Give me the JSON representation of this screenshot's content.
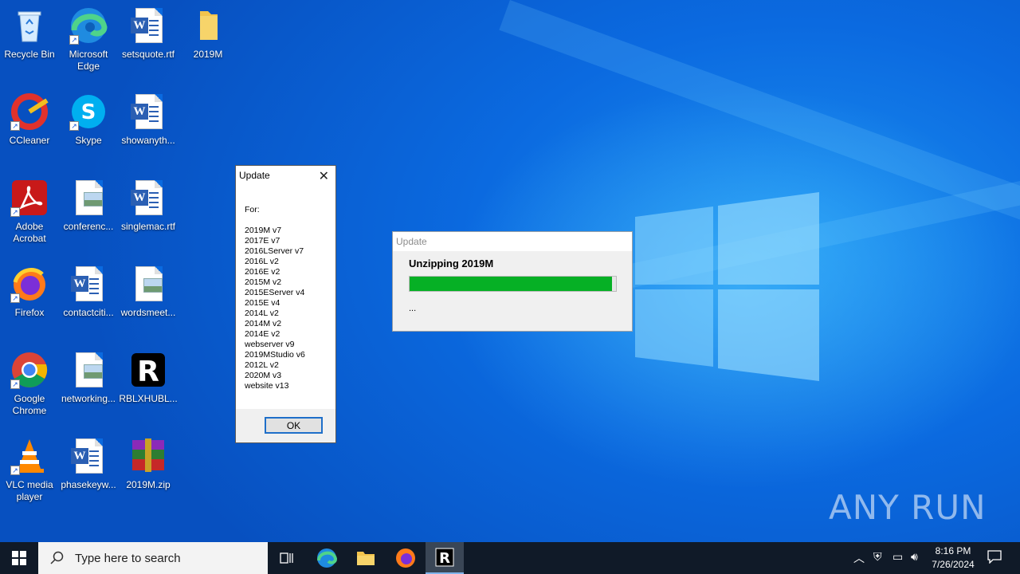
{
  "desktop": {
    "icons": [
      {
        "label": "Recycle Bin",
        "icon": "recycle-bin-icon"
      },
      {
        "label": "Microsoft Edge",
        "icon": "edge-icon"
      },
      {
        "label": "setsquote.rtf",
        "icon": "word-doc-icon"
      },
      {
        "label": "2019M",
        "icon": "folder-icon"
      },
      {
        "label": "CCleaner",
        "icon": "ccleaner-icon"
      },
      {
        "label": "Skype",
        "icon": "skype-icon"
      },
      {
        "label": "showanyth...",
        "icon": "word-doc-icon"
      },
      {
        "label": "Adobe Acrobat",
        "icon": "acrobat-icon"
      },
      {
        "label": "conferenc...",
        "icon": "image-file-icon"
      },
      {
        "label": "singlemac.rtf",
        "icon": "word-doc-icon"
      },
      {
        "label": "Firefox",
        "icon": "firefox-icon"
      },
      {
        "label": "contactciti...",
        "icon": "word-doc-icon"
      },
      {
        "label": "wordsmeet...",
        "icon": "image-file-icon"
      },
      {
        "label": "Google Chrome",
        "icon": "chrome-icon"
      },
      {
        "label": "networking...",
        "icon": "image-file-icon"
      },
      {
        "label": "RBLXHUBL...",
        "icon": "roblox-icon"
      },
      {
        "label": "VLC media player",
        "icon": "vlc-icon"
      },
      {
        "label": "phasekeyw...",
        "icon": "word-doc-icon"
      },
      {
        "label": "2019M.zip",
        "icon": "winrar-icon"
      }
    ]
  },
  "list_dialog": {
    "title": "Update",
    "for_label": "For:",
    "items": [
      "2019M v7",
      "2017E v7",
      "2016LServer v7",
      "2016L v2",
      "2016E v2",
      "2015M v2",
      "2015EServer v4",
      "2015E v4",
      "2014L v2",
      "2014M v2",
      "2014E v2",
      "webserver v9",
      "2019MStudio v6",
      "2012L v2",
      "2020M v3",
      "website v13"
    ],
    "ok_label": "OK"
  },
  "progress_dialog": {
    "title": "Update",
    "status": "Unzipping 2019M",
    "progress_fraction": 0.98,
    "detail": "..."
  },
  "watermark": "ANY RUN",
  "taskbar": {
    "search_placeholder": "Type here to search",
    "time": "8:16 PM",
    "date": "7/26/2024"
  },
  "colors": {
    "progress_green": "#06b025",
    "taskbar_bg": "#101a28",
    "desktop_blue": "#0b6ae0"
  }
}
